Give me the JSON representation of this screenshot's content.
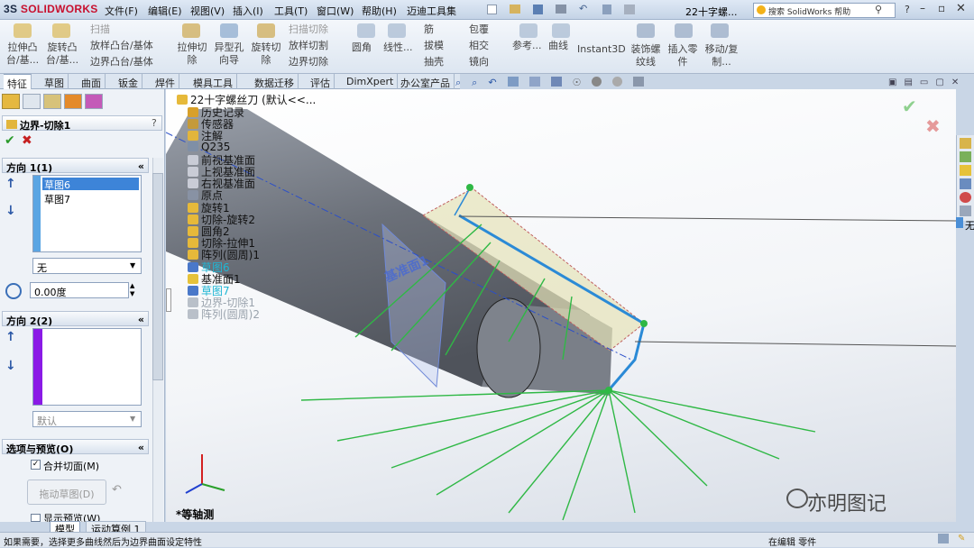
{
  "app": {
    "logo_prefix": "3S",
    "logo_text": "SOLIDWORKS"
  },
  "menu": [
    "文件(F)",
    "编辑(E)",
    "视图(V)",
    "插入(I)",
    "工具(T)",
    "窗口(W)",
    "帮助(H)",
    "迈迪工具集"
  ],
  "window_title": "22十字螺...",
  "search": {
    "placeholder": "搜索 SolidWorks 帮助"
  },
  "ribbon": {
    "features": [
      {
        "label": "拉伸凸台/基..."
      },
      {
        "label": "旋转凸台/基..."
      },
      {
        "label": "扫描"
      },
      {
        "label": "放样凸台/基体"
      },
      {
        "label": "边界凸台/基体"
      },
      {
        "label": "拉伸切除"
      },
      {
        "label": "异型孔向导"
      },
      {
        "label": "旋转切除"
      },
      {
        "label": "扫描切除"
      },
      {
        "label": "放样切割"
      },
      {
        "label": "边界切除"
      },
      {
        "label": "圆角"
      },
      {
        "label": "线性..."
      },
      {
        "label": "筋"
      },
      {
        "label": "拔模"
      },
      {
        "label": "抽壳"
      },
      {
        "label": "包覆"
      },
      {
        "label": "相交"
      },
      {
        "label": "镜向"
      },
      {
        "label": "参考..."
      },
      {
        "label": "曲线"
      },
      {
        "label": "Instant3D"
      },
      {
        "label": "装饰螺纹线"
      },
      {
        "label": "插入零件"
      },
      {
        "label": "移动/复制..."
      }
    ]
  },
  "tabs": [
    "特征",
    "草图",
    "曲面",
    "钣金",
    "焊件",
    "模具工具",
    "数据迁移",
    "评估",
    "DimXpert",
    "办公室产品"
  ],
  "panel": {
    "title": "边界-切除1",
    "help": "?",
    "direction1": {
      "title": "方向 1(1)",
      "items": [
        "草图6",
        "草图7"
      ],
      "selected_index": 0,
      "combo_value": "无",
      "angle_value": "0.00度"
    },
    "direction2": {
      "title": "方向 2(2)",
      "combo_value": "默认"
    },
    "options": {
      "title": "选项与预览(O)",
      "merge_label": "合并切面(M)",
      "drag_button": "拖动草图(D)",
      "preview_label": "显示预览(W)"
    }
  },
  "tree": {
    "root": "22十字螺丝刀  (默认<<...",
    "items": [
      {
        "label": "历史记录",
        "state": "normal",
        "color": "#d8a02a"
      },
      {
        "label": "传感器",
        "state": "normal",
        "color": "#c49a3a"
      },
      {
        "label": "注解",
        "state": "normal",
        "color": "#e2b53c"
      },
      {
        "label": "Q235",
        "state": "normal",
        "color": "#7f8fa6"
      },
      {
        "label": "前视基准面",
        "state": "normal",
        "color": "#c9ccd6"
      },
      {
        "label": "上视基准面",
        "state": "normal",
        "color": "#c9ccd6"
      },
      {
        "label": "右视基准面",
        "state": "normal",
        "color": "#c9ccd6"
      },
      {
        "label": "原点",
        "state": "normal",
        "color": "#8892a4"
      },
      {
        "label": "旋转1",
        "state": "normal",
        "color": "#e6b93a"
      },
      {
        "label": "切除-旋转2",
        "state": "normal",
        "color": "#e6b93a"
      },
      {
        "label": "圆角2",
        "state": "normal",
        "color": "#e6b93a"
      },
      {
        "label": "切除-拉伸1",
        "state": "normal",
        "color": "#e6b93a"
      },
      {
        "label": "阵列(圆周)1",
        "state": "normal",
        "color": "#e6b93a"
      },
      {
        "label": "草图6",
        "state": "highlight",
        "color": "#4a78c9"
      },
      {
        "label": "基准面1",
        "state": "normal",
        "color": "#e6c23a"
      },
      {
        "label": "草图7",
        "state": "highlight",
        "color": "#4a78c9"
      },
      {
        "label": "边界-切除1",
        "state": "gray",
        "color": "#b9c0c9"
      },
      {
        "label": "阵列(圆周)2",
        "state": "gray",
        "color": "#b9c0c9"
      }
    ]
  },
  "viewport": {
    "plane_label": "基准面1",
    "view_label": "*等轴测",
    "side_label": "无"
  },
  "bottom_tabs": [
    "模型",
    "运动算例 1"
  ],
  "status": {
    "message": "如果需要，选择更多曲线然后为边界曲面设定特性",
    "mode": "在编辑 零件"
  },
  "watermark": "亦明图记",
  "colors": {
    "accent": "#2c6fbf",
    "body": "#6f737c",
    "cut_fill": "#e6e3b8",
    "green_lines": "#2fb845"
  }
}
